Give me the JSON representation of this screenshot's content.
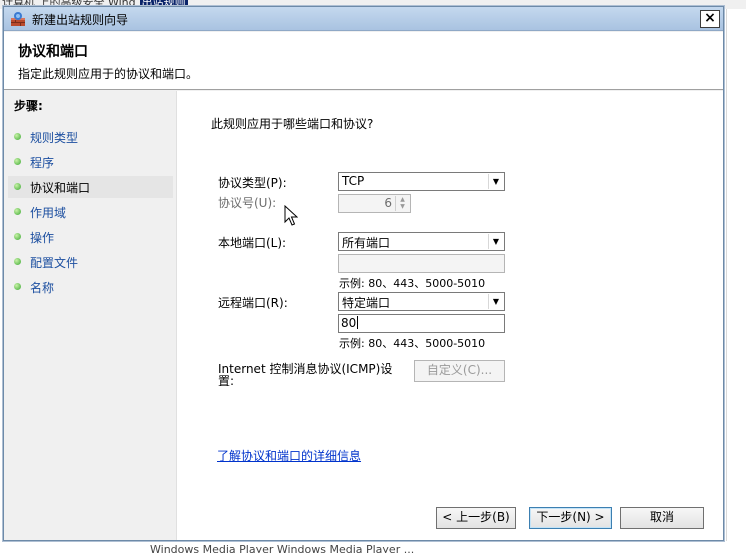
{
  "background": {
    "top_text": "计算机 上的高级安全 Wind",
    "top_highlight": "出站规则",
    "bottom_text": "Windows Media Player   Windows Media Player   ..."
  },
  "window": {
    "title": "新建出站规则向导",
    "close_label": "×"
  },
  "header": {
    "title": "协议和端口",
    "subtitle": "指定此规则应用于的协议和端口。"
  },
  "steps": {
    "label": "步骤:",
    "items": [
      {
        "label": "规则类型",
        "active": false
      },
      {
        "label": "程序",
        "active": false
      },
      {
        "label": "协议和端口",
        "active": true
      },
      {
        "label": "作用域",
        "active": false
      },
      {
        "label": "操作",
        "active": false
      },
      {
        "label": "配置文件",
        "active": false
      },
      {
        "label": "名称",
        "active": false
      }
    ]
  },
  "form": {
    "question": "此规则应用于哪些端口和协议?",
    "protocol_type_label": "协议类型(P):",
    "protocol_type_value": "TCP",
    "protocol_number_label": "协议号(U):",
    "protocol_number_value": "6",
    "local_port_label": "本地端口(L):",
    "local_port_value": "所有端口",
    "local_port_text": "",
    "local_example": "示例: 80、443、5000-5010",
    "remote_port_label": "远程端口(R):",
    "remote_port_value": "特定端口",
    "remote_port_text": "80",
    "remote_example": "示例: 80、443、5000-5010",
    "icmp_label": "Internet 控制消息协议(ICMP)设置:",
    "customize_button": "自定义(C)...",
    "learn_more_link": "了解协议和端口的详细信息"
  },
  "footer": {
    "back_button": "< 上一步(B)",
    "next_button": "下一步(N) >",
    "cancel_button": "取消"
  },
  "colors": {
    "step_link": "#1c4fa0",
    "link": "#0033cc",
    "titlebar": "#b7cde8"
  }
}
